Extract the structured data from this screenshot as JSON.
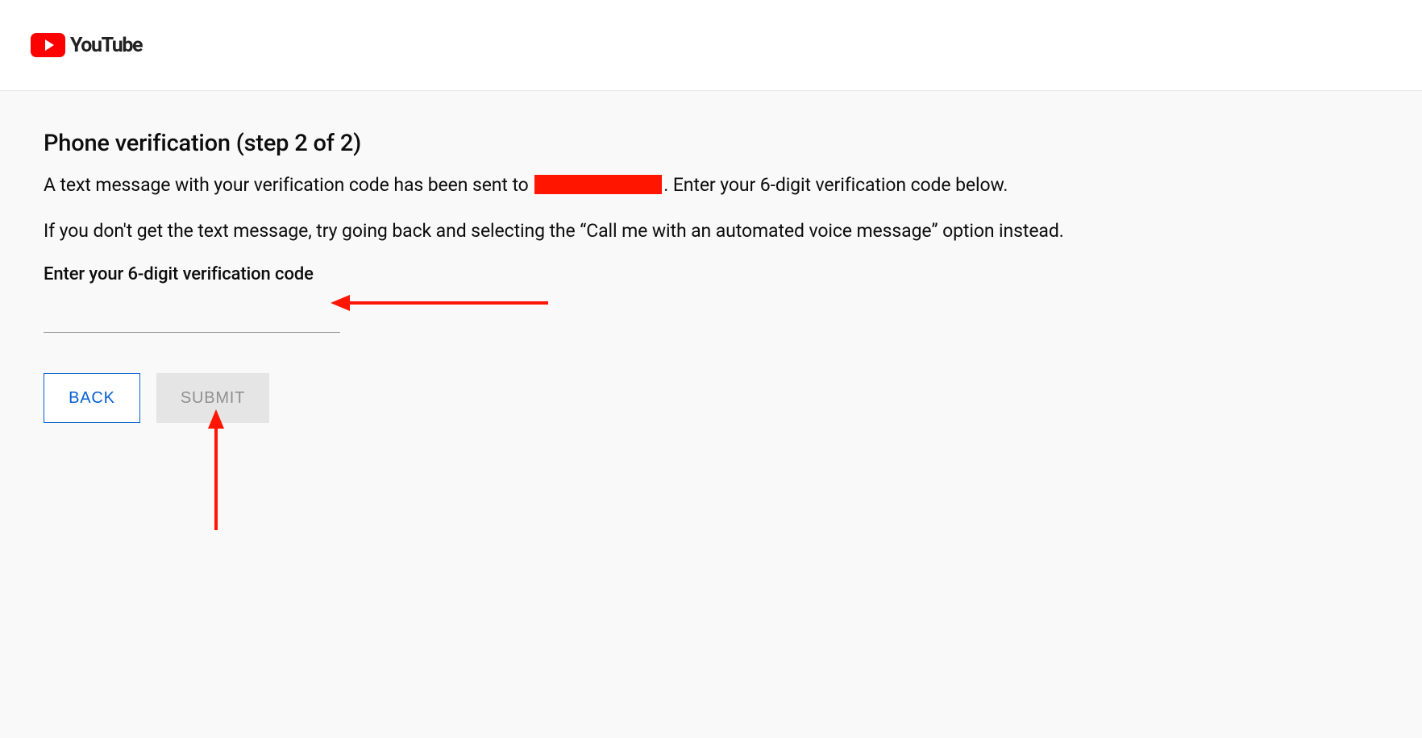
{
  "header": {
    "brand_text": "YouTube"
  },
  "page": {
    "title": "Phone verification (step 2 of 2)",
    "description_prefix": "A text message with your verification code has been sent to ",
    "description_suffix": ". Enter your 6-digit verification code below.",
    "help_text": "If you don't get the text message, try going back and selecting the “Call me with an automated voice message” option instead.",
    "input_label": "Enter your 6-digit verification code",
    "code_value": ""
  },
  "buttons": {
    "back_label": "BACK",
    "submit_label": "SUBMIT"
  },
  "annotations": {
    "arrow_input": "arrow-pointing-to-input",
    "arrow_submit": "arrow-pointing-to-submit"
  }
}
